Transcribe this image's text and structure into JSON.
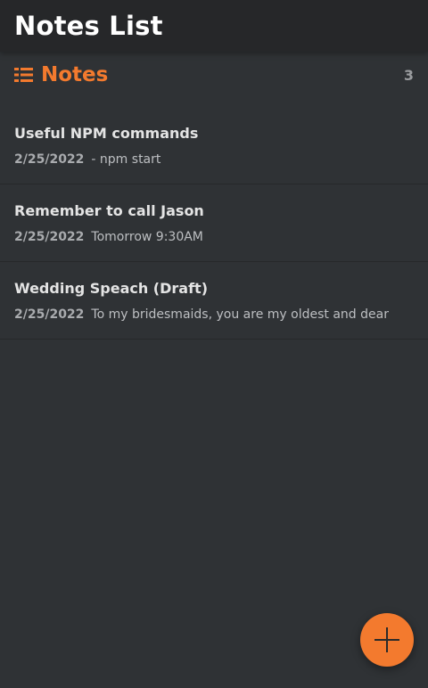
{
  "header": {
    "title": "Notes List"
  },
  "notes_section": {
    "title": "Notes",
    "count": "3",
    "icon": "list-icon"
  },
  "notes": [
    {
      "title": "Useful NPM commands",
      "date": "2/25/2022",
      "preview": "- npm start"
    },
    {
      "title": "Remember to call Jason",
      "date": "2/25/2022",
      "preview": "Tomorrow 9:30AM"
    },
    {
      "title": "Wedding Speach (Draft)",
      "date": "2/25/2022",
      "preview": "To my bridesmaids, you are my oldest and dear"
    }
  ],
  "fab": {
    "icon": "plus-icon"
  },
  "colors": {
    "accent": "#f37a2e",
    "background": "#2f3235",
    "header_background": "#262729"
  }
}
